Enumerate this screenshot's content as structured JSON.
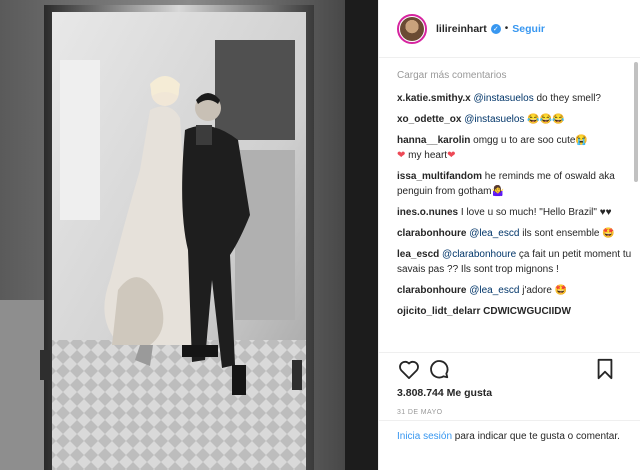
{
  "post": {
    "username": "lilireinhart",
    "follow_label": "Seguir",
    "separator": "•",
    "verified_icon": "check-icon"
  },
  "comments_section": {
    "load_more": "Cargar más comentarios",
    "items": [
      {
        "user": "x.katie.smithy.x",
        "mention": "@instasuelos",
        "text": " do they smell?"
      },
      {
        "user": "xo_odette_ox",
        "mention": "@instasuelos",
        "text": " 😂😂😂"
      },
      {
        "user": "hanna__karolin",
        "mention": "",
        "text": " omgg u to are soo cute😭",
        "line2_prefix": "❤",
        "line2_text": " my heart",
        "line2_suffix": "❤"
      },
      {
        "user": "issa_multifandom",
        "mention": "",
        "text": " he reminds me of oswald aka penguin from gotham🤷‍♀️"
      },
      {
        "user": "ines.o.nunes",
        "mention": "",
        "text": " I love u so much! \"Hello Brazil\" ♥♥"
      },
      {
        "user": "clarabonhoure",
        "mention": "@lea_escd",
        "text": " ils sont ensemble 🤩"
      },
      {
        "user": "lea_escd",
        "mention": "@clarabonhoure",
        "text": " ça fait un petit moment tu savais pas ?? Ils sont trop mignons !"
      },
      {
        "user": "clarabonhoure",
        "mention": "@lea_escd",
        "text": " j'adore 🤩"
      }
    ],
    "cut_line": "ojicito_lidt_delarr  CDWICWGUCIIDW"
  },
  "stats": {
    "likes": "3.808.744 Me gusta",
    "date": "31 DE MAYO"
  },
  "login_prompt": {
    "link": "Inicia sesión",
    "text": " para indicar que te gusta o comentar."
  },
  "colors": {
    "link_blue": "#3897f0",
    "mention_blue": "#003569",
    "muted": "#999999",
    "heart_red": "#ed4956"
  }
}
